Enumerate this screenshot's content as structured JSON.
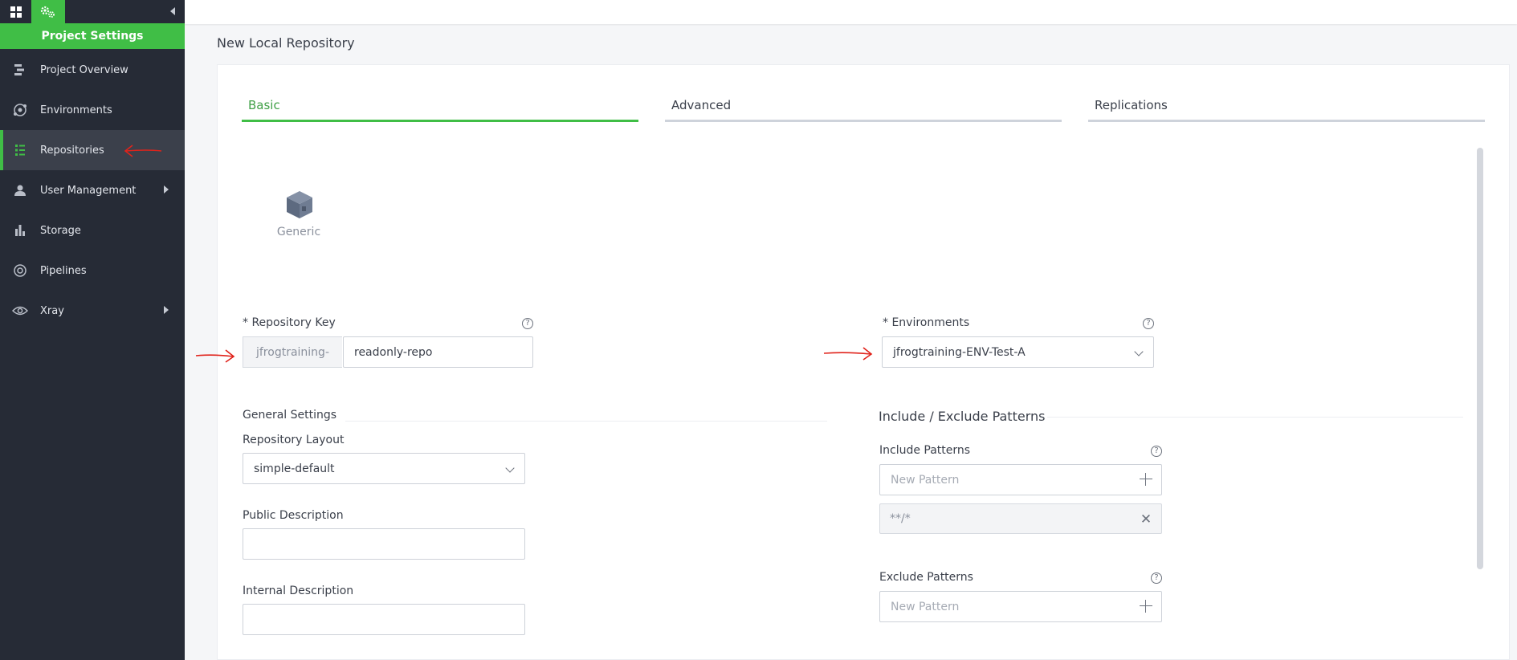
{
  "sidebar": {
    "header": "Project Settings",
    "items": [
      {
        "label": "Project Overview",
        "icon": "project-overview-icon"
      },
      {
        "label": "Environments",
        "icon": "environments-icon"
      },
      {
        "label": "Repositories",
        "icon": "repositories-icon",
        "active": true
      },
      {
        "label": "User Management",
        "icon": "user-icon",
        "expandable": true
      },
      {
        "label": "Storage",
        "icon": "storage-icon"
      },
      {
        "label": "Pipelines",
        "icon": "pipelines-icon"
      },
      {
        "label": "Xray",
        "icon": "xray-eye-icon",
        "expandable": true
      }
    ]
  },
  "page": {
    "title": "New Local Repository"
  },
  "tabs": [
    {
      "label": "Basic",
      "active": true
    },
    {
      "label": "Advanced"
    },
    {
      "label": "Replications"
    }
  ],
  "package": {
    "label": "Generic"
  },
  "form": {
    "repo_key_label": "* Repository Key",
    "repo_key_prefix": "jfrogtraining-",
    "repo_key_value": "readonly-repo",
    "environments_label": "* Environments",
    "environments_value": "jfrogtraining-ENV-Test-A",
    "general_settings_title": "General Settings",
    "repo_layout_label": "Repository Layout",
    "repo_layout_value": "simple-default",
    "public_desc_label": "Public Description",
    "public_desc_value": "",
    "internal_desc_label": "Internal Description",
    "internal_desc_value": "",
    "patterns_title": "Include / Exclude Patterns",
    "include_label": "Include Patterns",
    "include_placeholder": "New Pattern",
    "include_chip": "**/*",
    "exclude_label": "Exclude Patterns",
    "exclude_placeholder": "New Pattern",
    "help_glyph": "?"
  },
  "colors": {
    "accent": "#40be46",
    "sidebar_bg": "#262b36",
    "annotation_arrow": "#e0231b"
  }
}
